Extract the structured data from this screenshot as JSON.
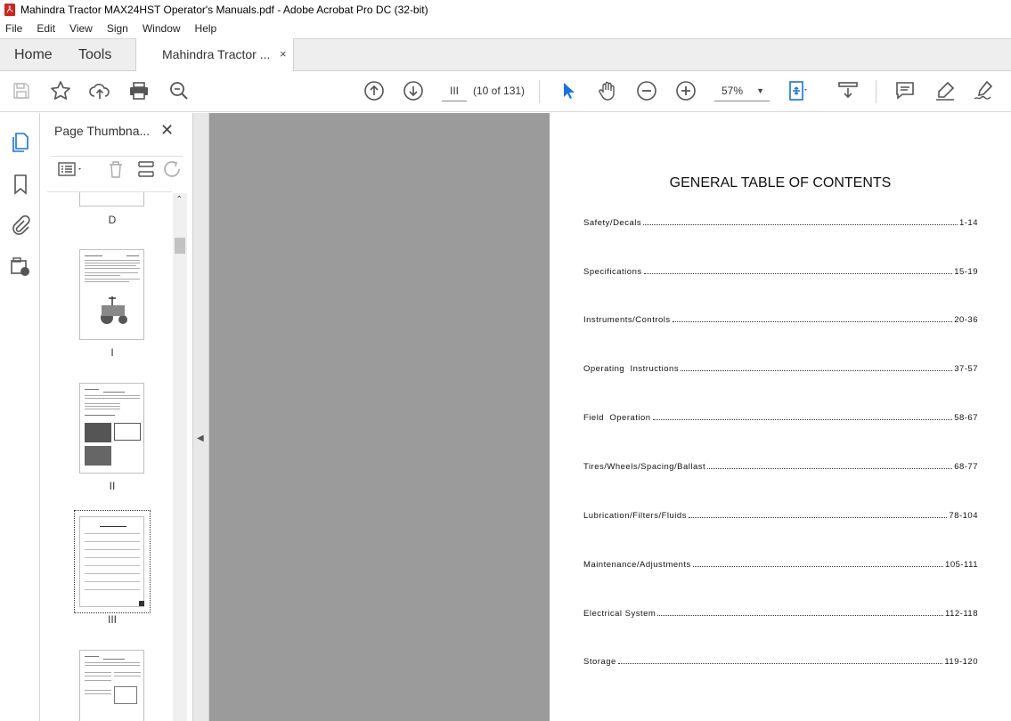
{
  "window": {
    "title": "Mahindra Tractor MAX24HST Operator's Manuals.pdf - Adobe Acrobat Pro DC (32-bit)"
  },
  "menu": [
    "File",
    "Edit",
    "View",
    "Sign",
    "Window",
    "Help"
  ],
  "tabs": {
    "home": "Home",
    "tools": "Tools",
    "document": "Mahindra Tractor ...",
    "close": "×"
  },
  "toolbar": {
    "page_value": "III",
    "page_count": "(10 of 131)",
    "zoom": "57%",
    "icons": [
      "save-icon",
      "bookmark-star-icon",
      "upload-icon",
      "print-icon",
      "zoom-search-icon",
      "page-up-icon",
      "page-down-icon",
      "select-cursor-icon",
      "hand-icon",
      "zoom-out-icon",
      "zoom-in-icon",
      "fit-page-icon",
      "scroll-mode-icon",
      "comment-icon",
      "highlight-icon",
      "sign-icon"
    ]
  },
  "left_rail": [
    "pages-icon",
    "bookmark-icon",
    "attachment-icon",
    "certificate-icon"
  ],
  "panel": {
    "title": "Page Thumbna...",
    "close": "✕",
    "thumbnails": [
      {
        "label": "D"
      },
      {
        "label": "I"
      },
      {
        "label": "II"
      },
      {
        "label": "III"
      },
      {
        "label": ""
      }
    ]
  },
  "document": {
    "heading": "GENERAL TABLE OF CONTENTS",
    "toc": [
      {
        "title": "Safety/Decals",
        "pages": "1-14"
      },
      {
        "title": "Specifications",
        "pages": "15-19"
      },
      {
        "title": "Instruments/Controls",
        "pages": "20-36"
      },
      {
        "title": "Operating  Instructions",
        "pages": "37-57"
      },
      {
        "title": "Field  Operation",
        "pages": "58-67"
      },
      {
        "title": "Tires/Wheels/Spacing/Ballast",
        "pages": "68-77"
      },
      {
        "title": "Lubrication/Filters/Fluids",
        "pages": "78-104"
      },
      {
        "title": "Maintenance/Adjustments",
        "pages": "105-111"
      },
      {
        "title": "Electrical System",
        "pages": "112-118"
      },
      {
        "title": "Storage",
        "pages": "119-120"
      }
    ]
  },
  "colors": {
    "accent": "#1473e6",
    "doc_bg": "#9b9b9b",
    "icon_gray": "#555555"
  }
}
